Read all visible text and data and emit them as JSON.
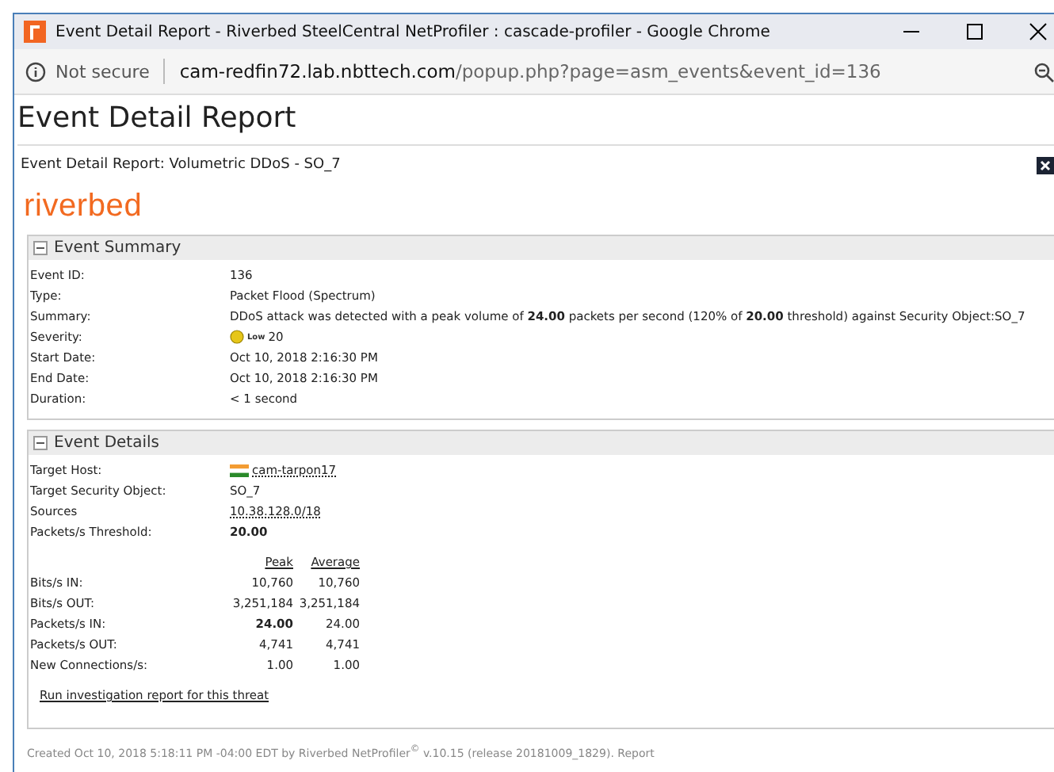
{
  "window": {
    "title": "Event Detail Report - Riverbed SteelCentral NetProfiler : cascade-profiler - Google Chrome"
  },
  "address_bar": {
    "security": "Not secure",
    "host": "cam-redfin72.lab.nbttech.com",
    "path": "/popup.php?page=asm_events&event_id=136"
  },
  "page": {
    "heading": "Event Detail Report",
    "subtitle": "Event Detail Report: Volumetric DDoS - SO_7",
    "logo": "riverbed"
  },
  "summary": {
    "title": "Event Summary",
    "expanded": true,
    "rows": [
      {
        "label": "Event ID:",
        "kind": "text",
        "value": "136"
      },
      {
        "label": "Type:",
        "kind": "text",
        "value": "Packet Flood (Spectrum)"
      },
      {
        "label": "Summary:",
        "kind": "text",
        "value": "DDoS attack was detected with a peak volume of **24.00** packets per second (120% of **20.00** threshold) against Security Object:SO_7"
      },
      {
        "label": "Severity:",
        "kind": "severity",
        "badge": "Low",
        "value": "20"
      },
      {
        "label": "Start Date:",
        "kind": "text",
        "value": "Oct 10, 2018 2:16:30 PM"
      },
      {
        "label": "End Date:",
        "kind": "text",
        "value": "Oct 10, 2018 2:16:30 PM"
      },
      {
        "label": "Duration:",
        "kind": "text",
        "value": "< 1 second"
      }
    ]
  },
  "details": {
    "title": "Event Details",
    "expanded": true,
    "rows": [
      {
        "label": "Target Host:",
        "kind": "host",
        "value": "cam-tarpon17"
      },
      {
        "label": "Target Security Object:",
        "kind": "text",
        "value": "SO_7"
      },
      {
        "label": "Sources",
        "kind": "link",
        "value": "10.38.128.0/18"
      },
      {
        "label": "Packets/s Threshold:",
        "kind": "bold",
        "value": "20.00"
      }
    ],
    "columns": [
      "Peak",
      "Average"
    ],
    "metrics": [
      {
        "label": "Bits/s IN:",
        "peak": "10,760",
        "average": "10,760",
        "peak_bold": false
      },
      {
        "label": "Bits/s OUT:",
        "peak": "3,251,184",
        "average": "3,251,184",
        "peak_bold": false
      },
      {
        "label": "Packets/s IN:",
        "peak": "24.00",
        "average": "24.00",
        "peak_bold": true
      },
      {
        "label": "Packets/s OUT:",
        "peak": "4,741",
        "average": "4,741",
        "peak_bold": false
      },
      {
        "label": "New Connections/s:",
        "peak": "1.00",
        "average": "1.00",
        "peak_bold": false
      }
    ],
    "link": "Run investigation report for this threat"
  },
  "footer": "Created Oct 10, 2018 5:18:11 PM -04:00 EDT by Riverbed NetProfiler$^{©}$ v.10.15 (release 20181009_1829). Report"
}
